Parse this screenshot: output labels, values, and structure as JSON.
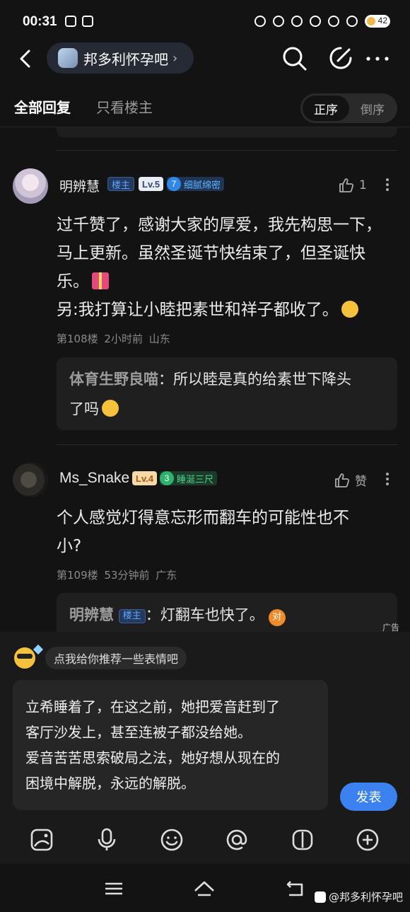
{
  "status_bar": {
    "time": "00:31",
    "battery": "42"
  },
  "nav": {
    "forum_name": "邦多利怀孕吧",
    "forum_chevron": "›"
  },
  "tabs": {
    "all_replies": "全部回复",
    "only_op": "只看楼主",
    "order_asc": "正序",
    "order_desc": "倒序"
  },
  "posts": [
    {
      "username": "明辨慧",
      "op_badge": "楼主",
      "level": "Lv.5",
      "title_num": "7",
      "title_name": "细腻绵密",
      "likes": "1",
      "content_line1": "过千赞了，感谢大家的厚爱，我先构思一下，",
      "content_line2": "马上更新。虽然圣诞节快结束了，但圣诞快",
      "content_line3": "乐。",
      "content_line4": "另:我打算让小睦把素世和祥子都收了。",
      "floor": "第108楼",
      "time": "2小时前",
      "location": "山东",
      "reply": {
        "name": "体育生野良喵",
        "sep": "：",
        "text_line1": "所以睦是真的给素世下降头",
        "text_line2": "了吗"
      }
    },
    {
      "username": "Ms_Snake",
      "level": "Lv.4",
      "title_num": "3",
      "title_name": "睡涎三尺",
      "likes": "赞",
      "content_line1": "个人感觉灯得意忘形而翻车的可能性也不",
      "content_line2": "小?",
      "floor": "第109楼",
      "time": "53分钟前",
      "location": "广东",
      "reply": {
        "name": "明辨慧",
        "op_badge": "楼主",
        "sep": "：",
        "text": "灯翻车也快了。",
        "emoji_text": "对"
      }
    }
  ],
  "ad_label": "广告",
  "compose": {
    "sticker_hint": "点我给你推荐一些表情吧",
    "draft_line1": "立希睡着了，在这之前，她把爱音赶到了",
    "draft_line2": "客厅沙发上，甚至连被子都没给她。",
    "draft_line3": "爱音苦苦思索破局之法，她好想从现在的",
    "draft_line4": "困境中解脱，永远的解脱。",
    "send_label": "发表"
  },
  "watermark": "@邦多利怀孕吧",
  "colors": {
    "background": "#131313",
    "accent_blue": "#3b82f0",
    "op_badge": "#5fa2ff"
  }
}
